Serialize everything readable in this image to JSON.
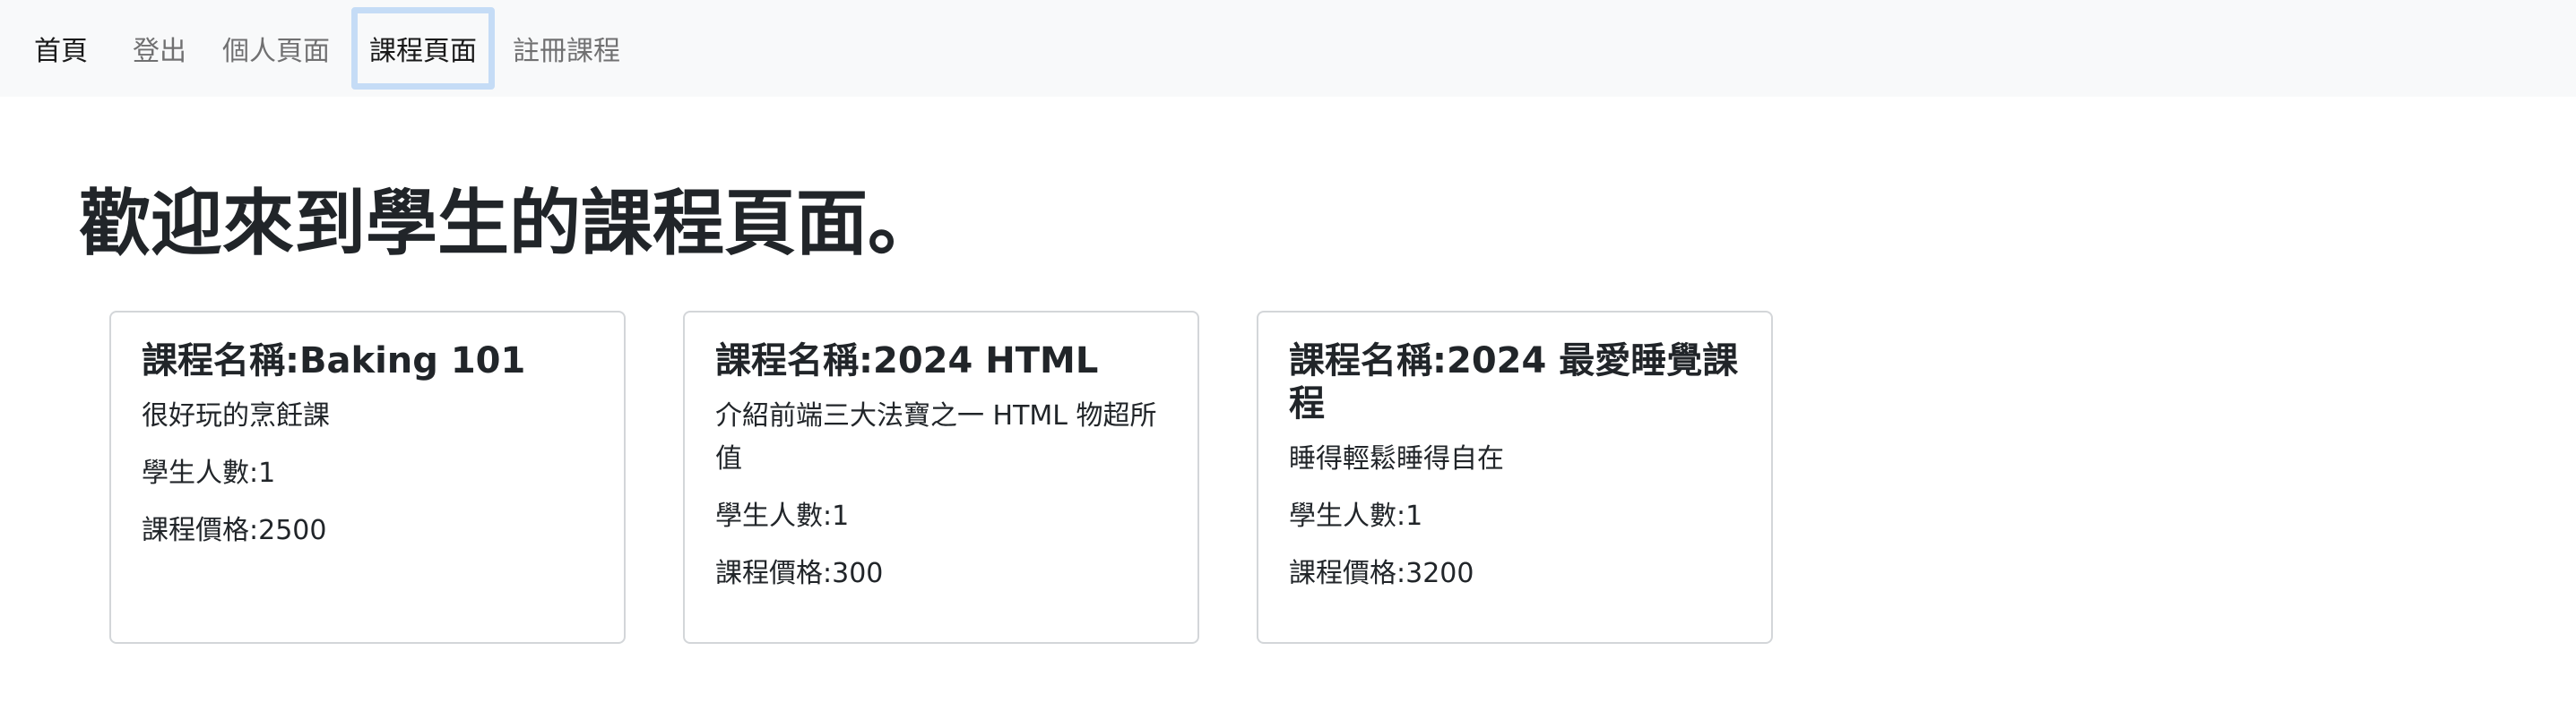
{
  "navbar": {
    "brand": "首頁",
    "items": [
      {
        "label": "登出"
      },
      {
        "label": "個人頁面"
      },
      {
        "label": "課程頁面"
      },
      {
        "label": "註冊課程"
      }
    ]
  },
  "page": {
    "title": "歡迎來到學生的課程頁面。"
  },
  "courses": [
    {
      "title": "課程名稱:Baking 101",
      "description": "很好玩的烹飪課",
      "students": "學生人數:1",
      "price": "課程價格:2500"
    },
    {
      "title": "課程名稱:2024 HTML",
      "description": "介紹前端三大法寶之一 HTML 物超所值",
      "students": "學生人數:1",
      "price": "課程價格:300"
    },
    {
      "title": "課程名稱:2024 最愛睡覺課程",
      "description": "睡得輕鬆睡得自在",
      "students": "學生人數:1",
      "price": "課程價格:3200"
    }
  ],
  "colors": {
    "navbar_bg": "#f8f9fa",
    "active_focus_ring": "#c5dcf6",
    "card_border": "#d3d6d9",
    "text": "#212529"
  }
}
